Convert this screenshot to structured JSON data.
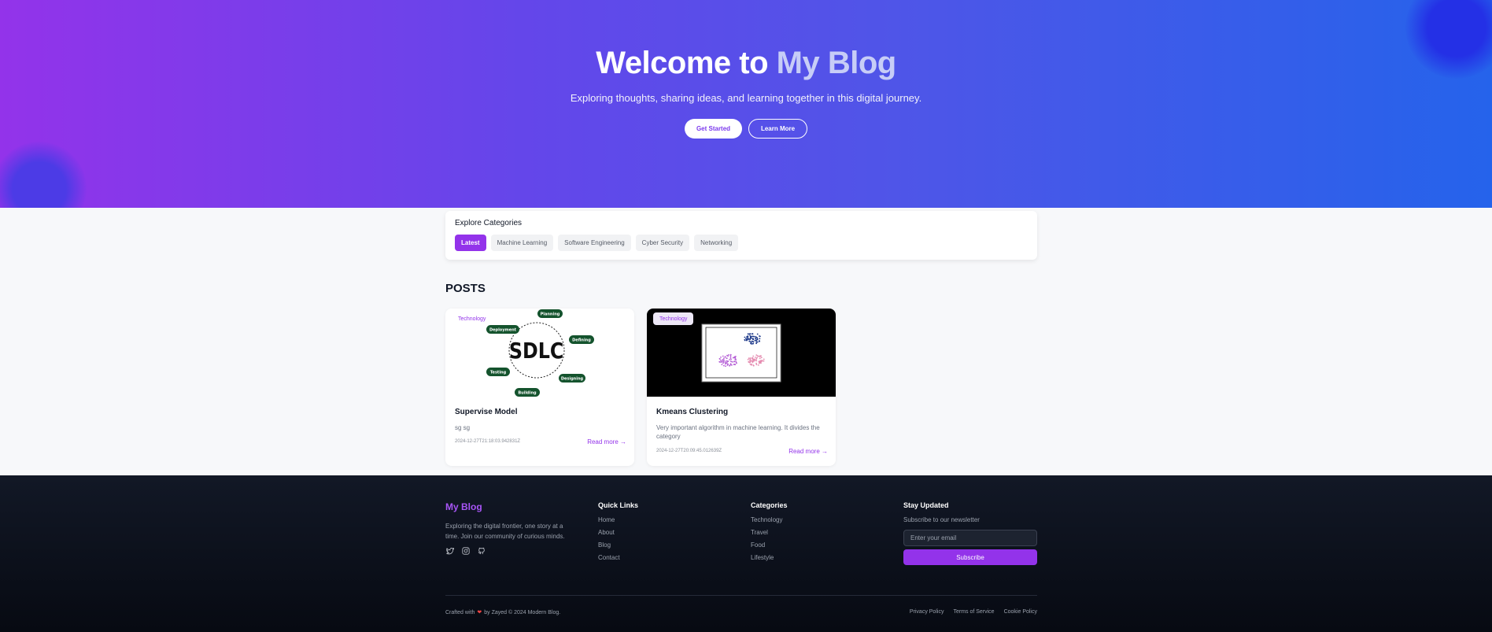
{
  "hero": {
    "title_prefix": "Welcome to",
    "title_accent": "My Blog",
    "subtitle": "Exploring thoughts, sharing ideas, and learning together in this digital journey.",
    "btn_primary": "Get Started",
    "btn_secondary": "Learn More"
  },
  "categories": {
    "title": "Explore Categories",
    "items": [
      {
        "label": "Latest",
        "active": true
      },
      {
        "label": "Machine Learning",
        "active": false
      },
      {
        "label": "Software Engineering",
        "active": false
      },
      {
        "label": "Cyber Security",
        "active": false
      },
      {
        "label": "Networking",
        "active": false
      }
    ]
  },
  "posts": {
    "title": "POSTS",
    "items": [
      {
        "tag": "Technology",
        "image_label": "SDLC",
        "image_nodes": [
          "Planning",
          "Defining",
          "Designing",
          "Building",
          "Testing",
          "Deployment"
        ],
        "title": "Supervise Model",
        "excerpt": "sg sg",
        "date": "2024-12-27T21:18:03.942831Z",
        "read_more": "Read more →"
      },
      {
        "tag": "Technology",
        "title": "Kmeans Clustering",
        "excerpt": "Very important algorithm in machine learning. It divides the category",
        "date": "2024-12-27T20:09:45.012639Z",
        "read_more": "Read more →"
      }
    ]
  },
  "footer": {
    "brand": "My Blog",
    "description": "Exploring the digital frontier, one story at a time. Join our community of curious minds.",
    "social_icons": [
      "twitter-icon",
      "instagram-icon",
      "github-icon"
    ],
    "quick_links": {
      "title": "Quick Links",
      "items": [
        "Home",
        "About",
        "Blog",
        "Contact"
      ]
    },
    "categories": {
      "title": "Categories",
      "items": [
        "Technology",
        "Travel",
        "Food",
        "Lifestyle"
      ]
    },
    "newsletter": {
      "title": "Stay Updated",
      "subtitle": "Subscribe to our newsletter",
      "placeholder": "Enter your email",
      "button": "Subscribe"
    },
    "copyright_prefix": "Crafted with",
    "copyright_suffix": "by Zayed © 2024 Modern Blog.",
    "legal": [
      "Privacy Policy",
      "Terms of Service",
      "Cookie Policy"
    ]
  },
  "colors": {
    "accent": "#9333ea",
    "hero_start": "#9333ea",
    "hero_end": "#2563eb",
    "footer_bg": "#0b0f19"
  }
}
